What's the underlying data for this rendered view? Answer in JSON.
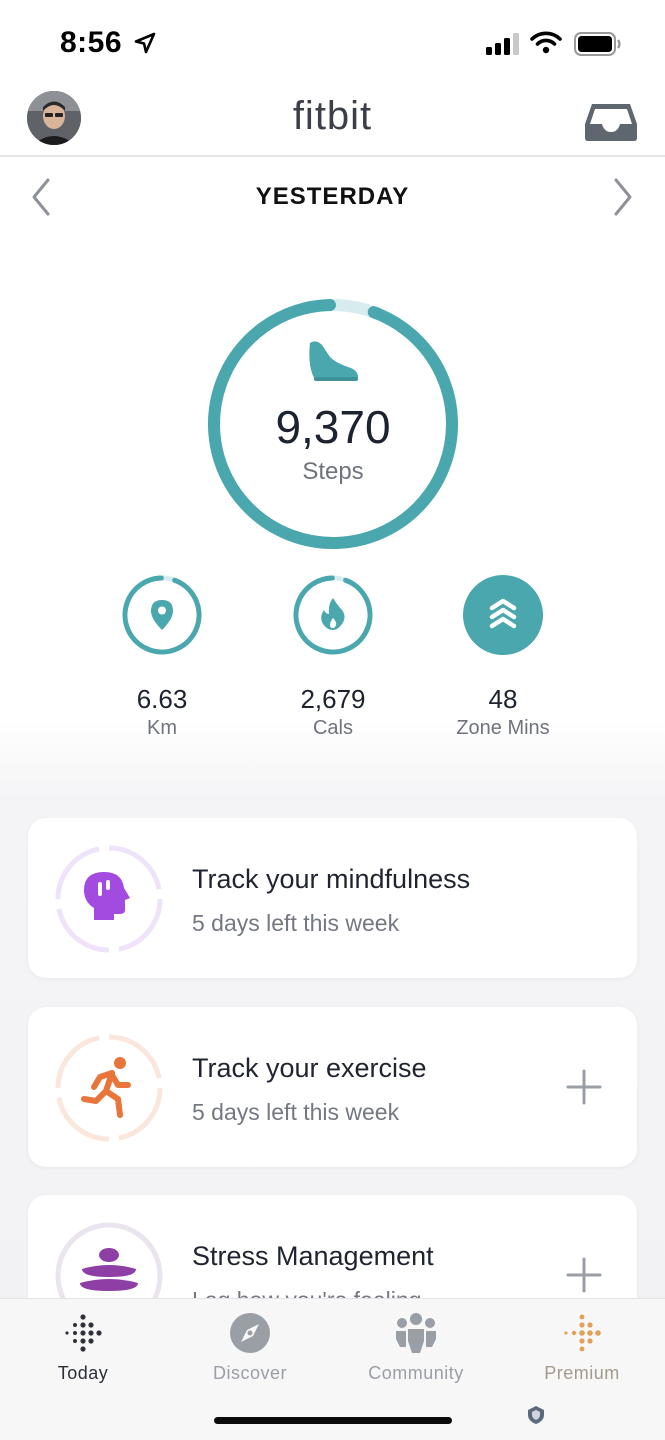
{
  "status_bar": {
    "time": "8:56"
  },
  "header": {
    "brand": "fitbit"
  },
  "date_nav": {
    "label": "YESTERDAY"
  },
  "steps": {
    "value": "9,370",
    "label": "Steps",
    "progress": 0.94
  },
  "stats": [
    {
      "value": "6.63",
      "label": "Km",
      "progress": 0.94
    },
    {
      "value": "2,679",
      "label": "Cals",
      "progress": 0.94
    },
    {
      "value": "48",
      "label": "Zone Mins",
      "progress": 1.0
    }
  ],
  "cards": [
    {
      "title": "Track your mindfulness",
      "subtitle": "5 days left this week"
    },
    {
      "title": "Track your exercise",
      "subtitle": "5 days left this week"
    },
    {
      "title": "Stress Management",
      "subtitle": "Log how you're feeling"
    }
  ],
  "bottom_nav": [
    {
      "label": "Today",
      "icon": "fitbit-dots-icon"
    },
    {
      "label": "Discover",
      "icon": "compass-icon"
    },
    {
      "label": "Community",
      "icon": "community-icon"
    },
    {
      "label": "Premium",
      "icon": "premium-dots-icon"
    }
  ],
  "colors": {
    "teal": "#4aa7ad",
    "teal_light": "#d8eef0",
    "mindfulness": "#a34be0",
    "exercise": "#e8753a",
    "stress": "#8d3fa6",
    "premium": "#e0a15a"
  }
}
